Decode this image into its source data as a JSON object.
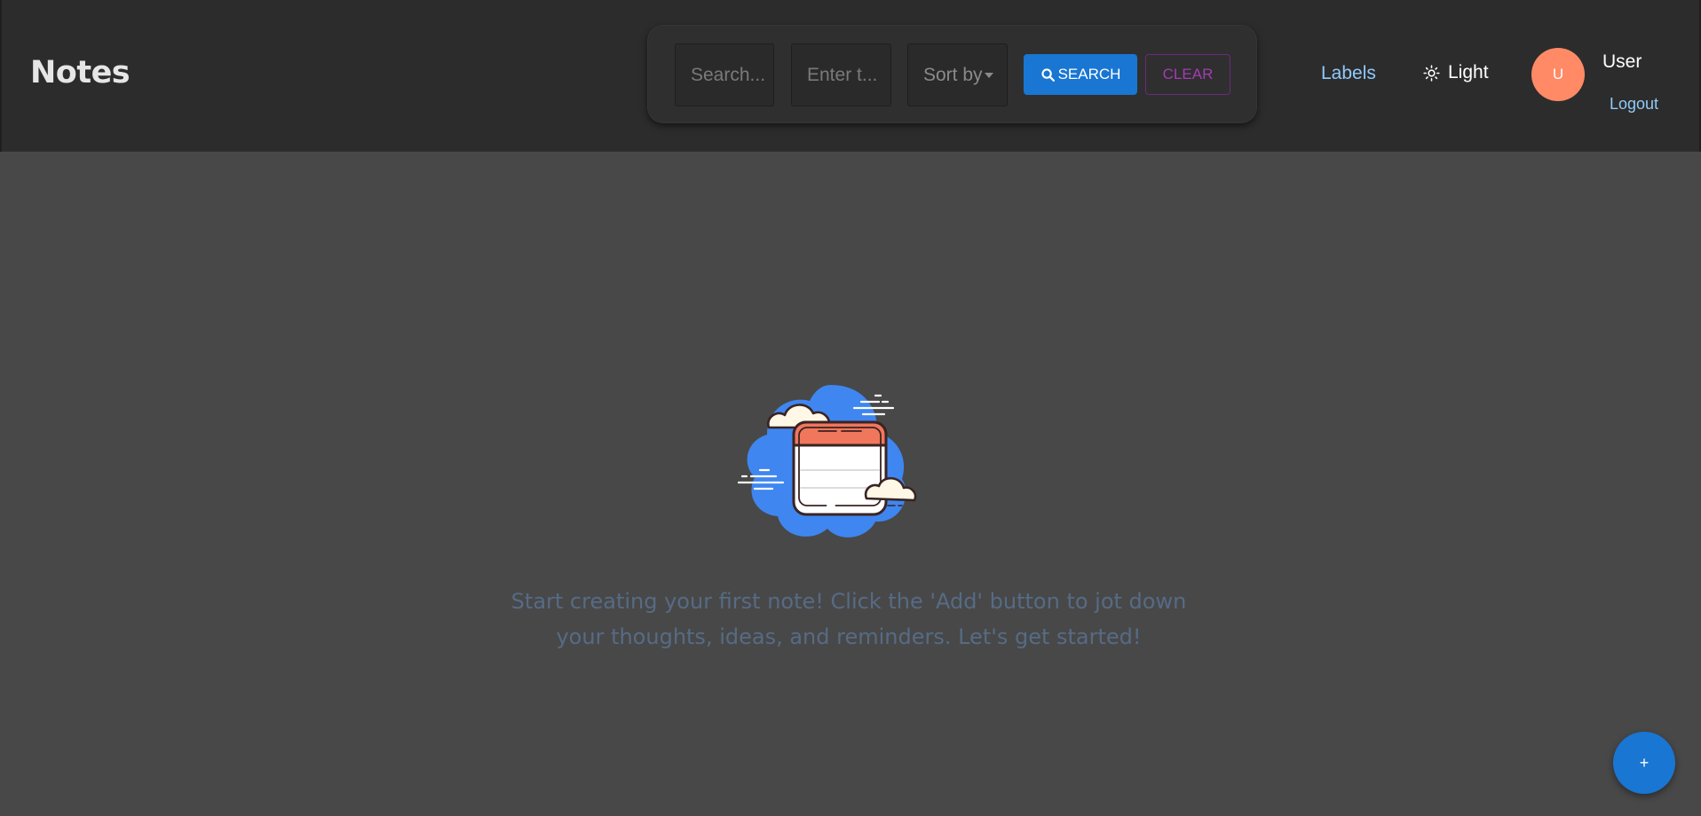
{
  "header": {
    "title": "Notes",
    "search": {
      "query_placeholder": "Search...",
      "tag_placeholder": "Enter t...",
      "sort_label": "Sort by",
      "search_button": "SEARCH",
      "clear_button": "CLEAR"
    },
    "nav": {
      "labels_link": "Labels",
      "theme_toggle_label": "Light"
    },
    "user": {
      "avatar_initial": "U",
      "name": "User",
      "logout": "Logout"
    }
  },
  "main": {
    "empty_message_line1": "Start creating your first note! Click the 'Add' button to jot down",
    "empty_message_line2": "your thoughts, ideas, and reminders. Let's get started!",
    "add_button": "+"
  },
  "colors": {
    "header_bg": "#2c2c2c",
    "page_bg": "#484848",
    "primary": "#1976d2",
    "secondary": "#a33bb5",
    "link": "#90caf9",
    "avatar": "#ff8a65",
    "empty_text": "#566b85"
  },
  "icons": [
    "search-icon",
    "sun-icon",
    "empty-notes-illustration"
  ]
}
